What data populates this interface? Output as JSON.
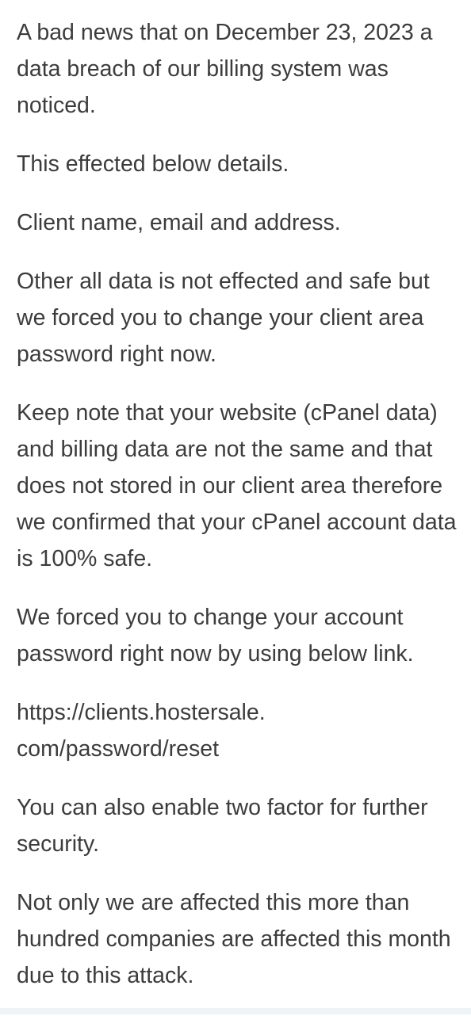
{
  "message": {
    "paragraphs": [
      "A bad news that on December 23, 2023 a data breach of our billing system was noticed.",
      "This effected below details.",
      "Client name, email and address.",
      "Other all data is not effected and safe but we forced you to change your client area password right now.",
      "Keep note that your website (cPanel data) and billing data are not the same and that does not stored in our client area therefore we confirmed that your cPanel account data is 100% safe.",
      "We forced you to change your account password right now by using below link."
    ],
    "link_part1": "https://clients.hostersale.",
    "link_part2": "com/password/reset",
    "paragraphs_after": [
      "You can also enable two factor for further security.",
      "Not only we are affected this more than hundred companies are affected this month due to this attack."
    ]
  }
}
